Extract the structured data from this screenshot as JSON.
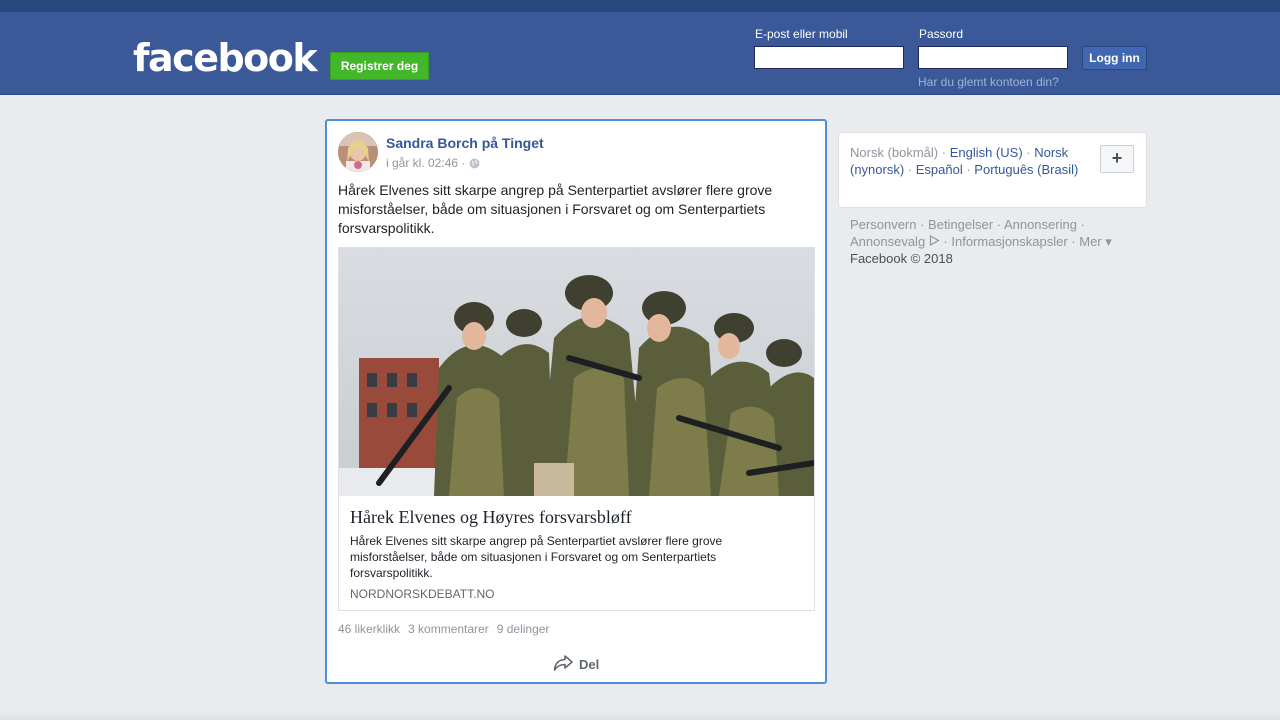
{
  "header": {
    "logo": "facebook",
    "register_label": "Registrer deg",
    "email_label": "E-post eller mobil",
    "password_label": "Passord",
    "login_label": "Logg inn",
    "forgot_label": "Har du glemt kontoen din?",
    "email_value": "",
    "password_value": ""
  },
  "post": {
    "author": "Sandra Borch på Tinget",
    "timestamp": "i går kl. 02:46 ·",
    "privacy_icon": "globe-icon",
    "text": "Hårek Elvenes sitt skarpe angrep på Senterpartiet avslører flere grove misforståelser, både om situasjonen i Forsvaret og om Senterpartiets forsvarspolitikk.",
    "link": {
      "title": "Hårek Elvenes og Høyres forsvarsbløff",
      "description": "Hårek Elvenes sitt skarpe angrep på Senterpartiet avslører flere grove misforståelser, både om situasjonen i Forsvaret og om Senterpartiets forsvarspolitikk.",
      "domain": "NORDNORSKDEBATT.NO"
    },
    "stats": {
      "likes": "46 likerklikk",
      "comments": "3 kommentarer",
      "shares": "9 delinger"
    },
    "share_label": "Del"
  },
  "languages": {
    "current": "Norsk (bokmål)",
    "links": [
      "English (US)",
      "Norsk (nynorsk)",
      "Español",
      "Português (Brasil)"
    ],
    "more_label": "+"
  },
  "footer": {
    "links": [
      "Personvern",
      "Betingelser",
      "Annonsering",
      "Annonsevalg",
      "Informasjonskapsler",
      "Mer"
    ],
    "copyright": "Facebook © 2018"
  },
  "colors": {
    "brand": "#3b5998",
    "register": "#42b72a",
    "link": "#365899",
    "focus_border": "#4a90d9"
  }
}
